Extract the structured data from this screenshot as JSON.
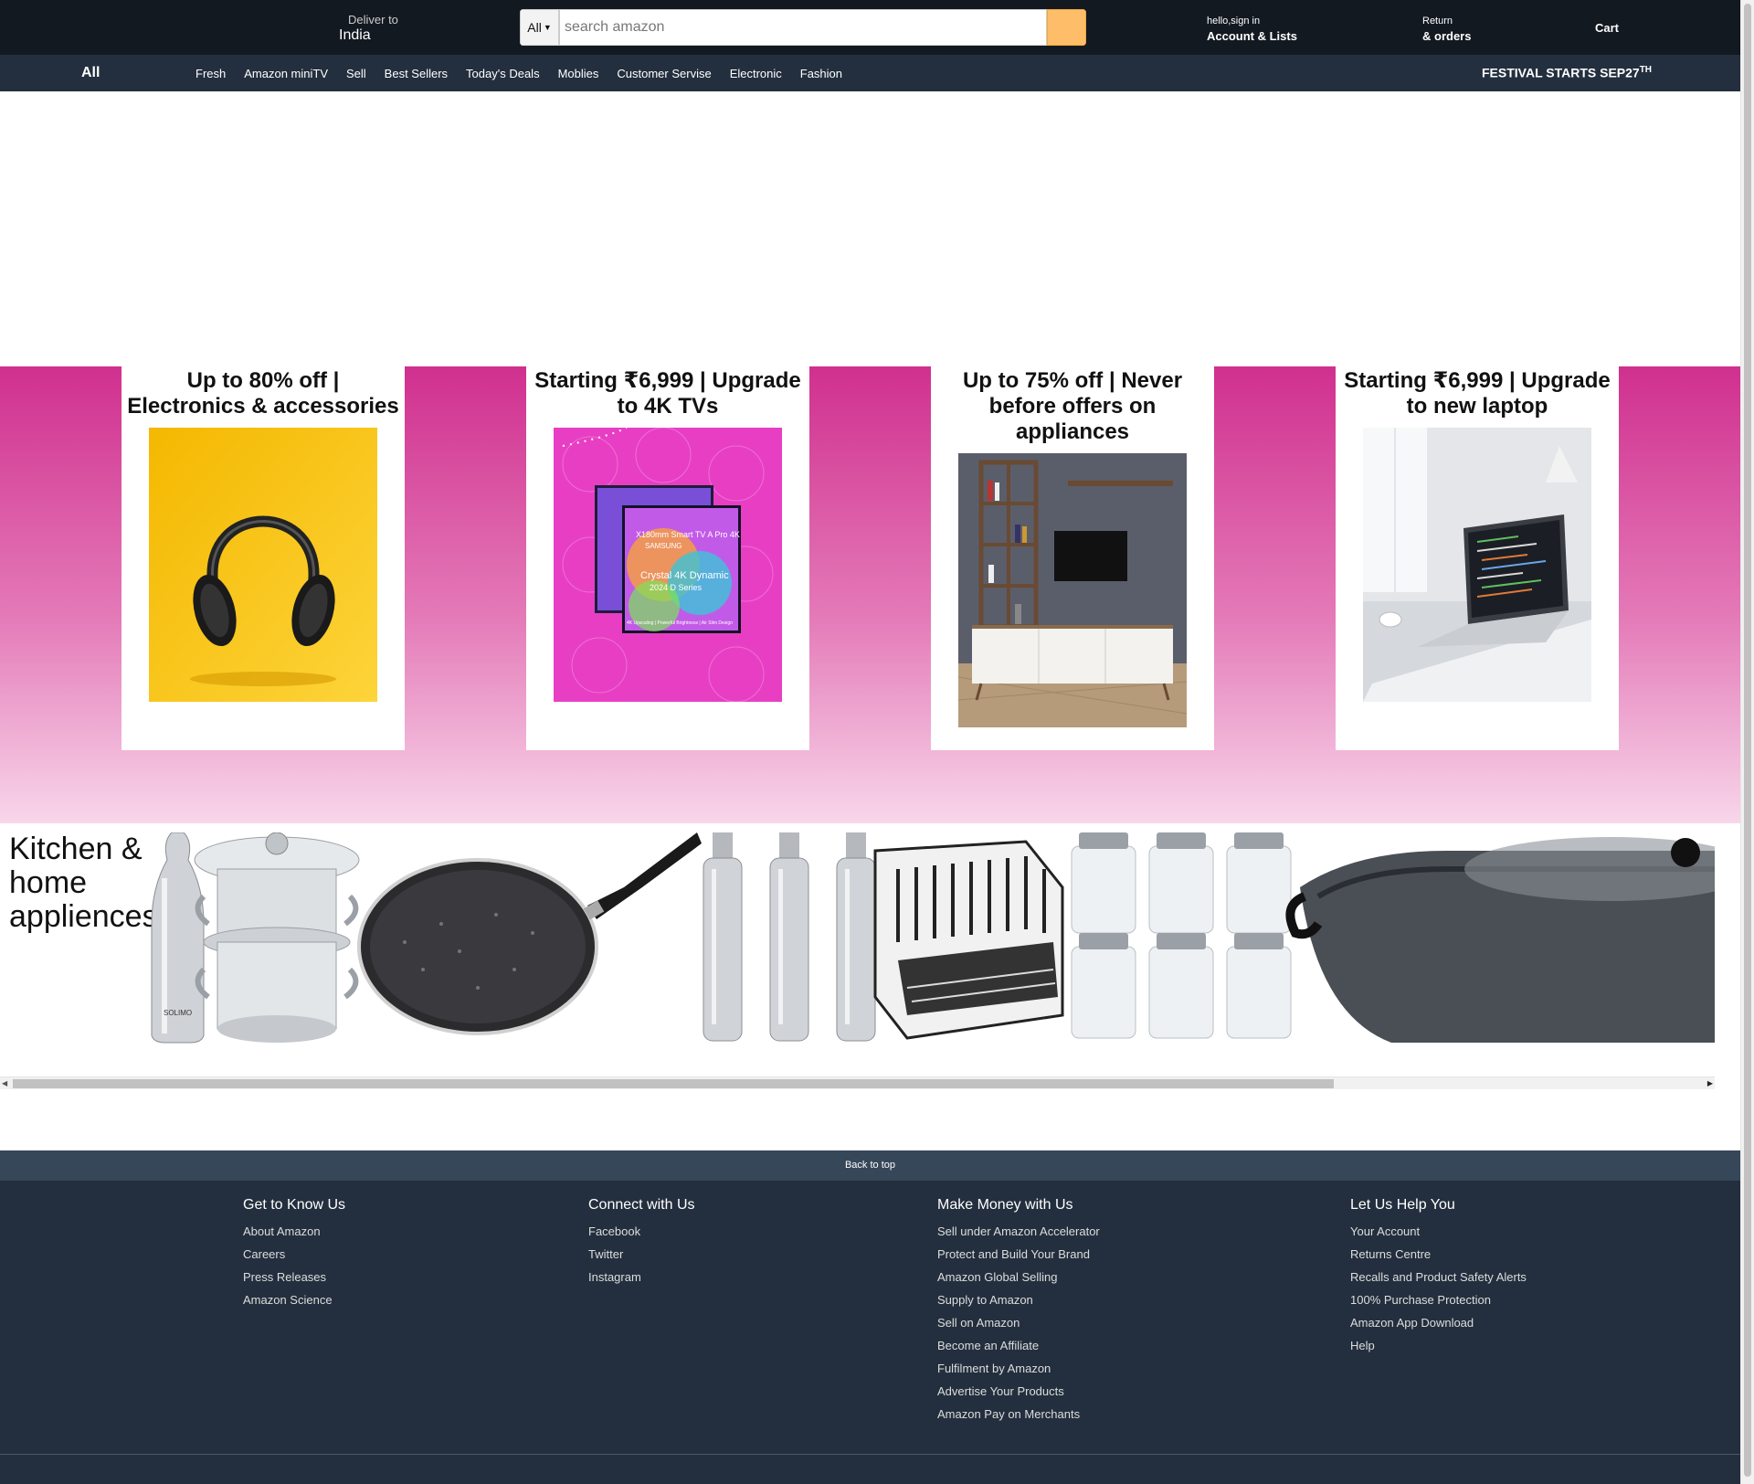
{
  "navbar": {
    "deliver_label": "Deliver to",
    "deliver_location": "India",
    "search_category": "All",
    "search_placeholder": "search amazon",
    "account_greeting": "hello,sign in",
    "account_label": "Account & Lists",
    "returns_label": "Return",
    "orders_label": "& orders",
    "cart_label": "Cart",
    "accent_color": "#febd69"
  },
  "subnav": {
    "all_label": "All",
    "links": [
      "Fresh",
      "Amazon miniTV",
      "Sell",
      "Best Sellers",
      "Today's Deals",
      "Moblies",
      "Customer Servise",
      "Electronic",
      "Fashion"
    ],
    "festival_text": "FESTIVAL STARTS SEP27",
    "festival_sup": "TH"
  },
  "hero": {
    "cards": [
      {
        "title": "Up to 80% off | Electronics & accessories",
        "icon": "headphones-image"
      },
      {
        "title": "Starting ₹6,999 | Upgrade to 4K TVs",
        "icon": "tv-image",
        "image_text": [
          "X180mm Smart TV A Pro 4K",
          "SAMSUNG",
          "Crystal 4K Dynamic",
          "2024 D Series",
          "4K Upscaling | Powerful Brightness | Air Slim Design"
        ]
      },
      {
        "title": "Up to 75% off | Never before offers on appliances",
        "icon": "tv-unit-image"
      },
      {
        "title": "Starting ₹6,999 | Upgrade to new laptop",
        "icon": "laptop-image"
      }
    ]
  },
  "kitchen": {
    "title": "Kitchen & home appliences",
    "products": [
      "steel-bottle",
      "steamer-pot",
      "frying-pan",
      "bottle-set",
      "dish-rack",
      "glass-jars",
      "kadai-pan"
    ],
    "brand_text": "SOLIMO"
  },
  "footer": {
    "back_to_top": "Back to top",
    "columns": [
      {
        "title": "Get to Know Us",
        "links": [
          "About Amazon",
          "Careers",
          "Press Releases",
          "Amazon Science"
        ]
      },
      {
        "title": "Connect with Us",
        "links": [
          "Facebook",
          "Twitter",
          "Instagram"
        ]
      },
      {
        "title": "Make Money with Us",
        "links": [
          "Sell under Amazon Accelerator",
          "Protect and Build Your Brand",
          "Amazon Global Selling",
          "Supply to Amazon",
          "Sell on Amazon",
          "Become an Affiliate",
          "Fulfilment by Amazon",
          "Advertise Your Products",
          "Amazon Pay on Merchants"
        ]
      },
      {
        "title": "Let Us Help You",
        "links": [
          "Your Account",
          "Returns Centre",
          "Recalls and Product Safety Alerts",
          "100% Purchase Protection",
          "Amazon App Download",
          "Help"
        ]
      }
    ]
  }
}
